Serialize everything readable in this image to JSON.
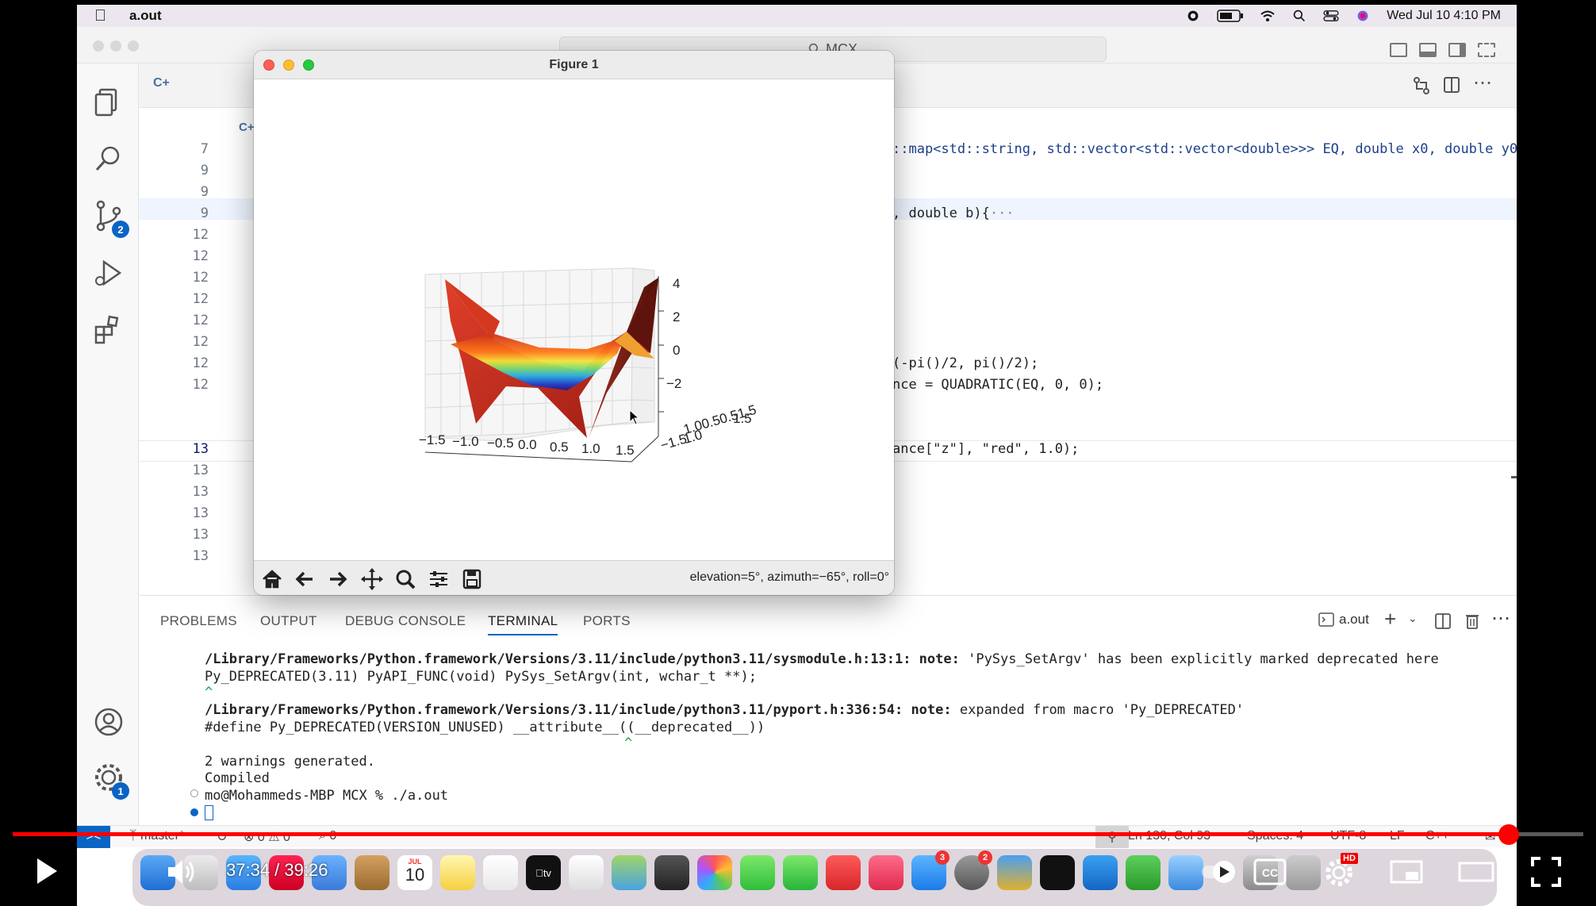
{
  "menubar": {
    "app_name": "a.out",
    "datetime": "Wed Jul 10  4:10 PM"
  },
  "titlebar": {
    "command_center": "MCX"
  },
  "activity": {
    "scm_badge": "2",
    "settings_badge": "1"
  },
  "editor": {
    "line_numbers": [
      "7",
      "9",
      "9",
      "9",
      "12",
      "12",
      "12",
      "12",
      "12",
      "12",
      "12",
      "12",
      "13",
      "13",
      "13",
      "13",
      "13",
      "13"
    ],
    "code": {
      "l1_a": "::map<std::string, std::vector<std::vector<double>>> EQ, double x0, double y0){",
      "l2_a": ", double b){",
      "l2_b": "···",
      "l3": "(-pi()/2, pi()/2);",
      "l4": "nce = QUADRATIC(EQ, 0, 0);",
      "l5": "ance[\"z\"], \"red\", 1.0);"
    }
  },
  "figure": {
    "title": "Figure 1",
    "z_ticks": [
      "4",
      "2",
      "0",
      "−2"
    ],
    "x_ticks": [
      "−1.5",
      "−1.0",
      "−0.5",
      "0.0",
      "0.5",
      "1.0",
      "1.5"
    ],
    "y_ticks_overlap": "−1.5",
    "y_ticks_overlap2": "1.00.50.51.5",
    "y_ticks_overlap3": "1.0",
    "y_ticks_top": "1.5",
    "coords": "elevation=5°, azimuth=−65°, roll=0°"
  },
  "panel": {
    "tabs": [
      "PROBLEMS",
      "OUTPUT",
      "DEBUG CONSOLE",
      "TERMINAL",
      "PORTS"
    ],
    "active_tab": "TERMINAL",
    "terminal_name": "a.out",
    "terminal": {
      "l1_path": "/Library/Frameworks/Python.framework/Versions/3.11/include/python3.11/sysmodule.h:13:1:",
      "l1_note": " note:",
      "l1_msg": " 'PySys_SetArgv' has been explicitly marked deprecated here",
      "l2": "Py_DEPRECATED(3.11) PyAPI_FUNC(void) PySys_SetArgv(int, wchar_t **);",
      "l3": "^",
      "l4_path": "/Library/Frameworks/Python.framework/Versions/3.11/include/python3.11/pyport.h:336:54:",
      "l4_note": " note:",
      "l4_msg": " expanded from macro 'Py_DEPRECATED'",
      "l5": "#define Py_DEPRECATED(VERSION_UNUSED) __attribute__((__deprecated__))",
      "l6": "^",
      "l7": "2 warnings generated.",
      "l8": "Compiled",
      "l9": "mo@Mohammeds-MBP MCX % ./a.out"
    }
  },
  "statusbar": {
    "branch": "master*",
    "problems": "0",
    "warnings": "0",
    "ports": "0",
    "position": "Ln 130, Col 93",
    "spaces": "Spaces: 4",
    "encoding": "UTF-8",
    "eol": "LF",
    "language": "C++"
  },
  "dock": {
    "calendar_month": "JUL",
    "calendar_day": "10",
    "appstore_badge": "3",
    "settings_badge": "2"
  },
  "player": {
    "time": "37:34 / 39:26",
    "progress": 0.9525,
    "hd_badge": "HD"
  },
  "colors": {
    "accent": "#0a64c4",
    "progress": "#ff0000"
  }
}
